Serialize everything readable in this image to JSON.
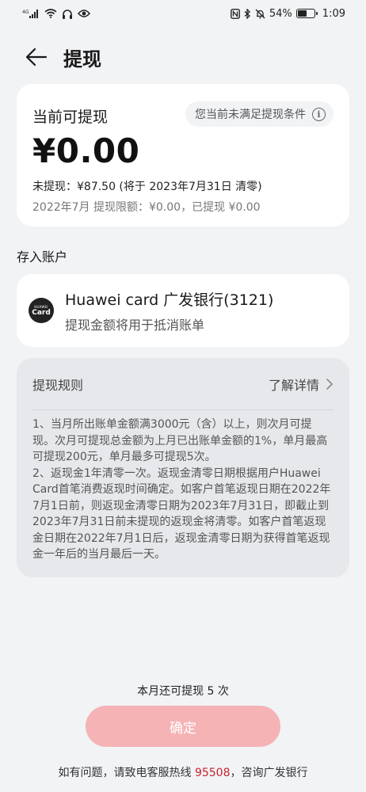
{
  "status_bar": {
    "network": "4G",
    "battery": "54%",
    "battery_level": 0.54,
    "time": "1:09"
  },
  "header": {
    "title": "提现",
    "back_icon": "arrow-left-icon"
  },
  "balance": {
    "label": "当前可提现",
    "condition_notice": "您当前未满足提现条件",
    "amount": "¥0.00",
    "pending": "未提现：¥87.50 (将于 2023年7月31日 清零)",
    "limit": "2022年7月 提现限额：¥0.00，已提现 ¥0.00"
  },
  "deposit": {
    "section_label": "存入账户",
    "logo_line1": "HUAWEI",
    "logo_line2": "Card",
    "account_name": "Huawei card 广发银行(3121)",
    "account_note": "提现金额将用于抵消账单"
  },
  "rules": {
    "title": "提现规则",
    "more": "了解详情",
    "body": "1、当月所出账单金额满3000元（含）以上，则次月可提现。次月可提现总金额为上月已出账单金额的1%，单月最高可提现200元，单月最多可提现5次。\n2、返现金1年清零一次。返现金清零日期根据用户Huawei Card首笔消费返现时间确定。如客户首笔返现日期在2022年7月1日前，则返现金清零日期为2023年7月31日，即截止到2023年7月31日前未提现的返现金将清零。如客户首笔返现金日期在2022年7月1日后，返现金清零日期为获得首笔返现金一年后的当月最后一天。"
  },
  "remaining": "本月还可提现 5 次",
  "confirm_button": "确定",
  "footer": {
    "prefix": "如有问题，请致电客服热线 ",
    "hotline": "95508",
    "suffix": "，咨询广发银行"
  },
  "colors": {
    "accent": "#c8232c",
    "button_disabled": "#f5b3b6",
    "background": "#f1f3f5"
  }
}
